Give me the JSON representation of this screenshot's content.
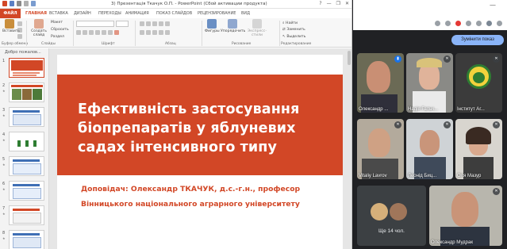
{
  "window": {
    "title": "3) Презентація Ткачук О.П. - PowerPoint (Сбой активации продукта)",
    "help": "?",
    "minimize": "—",
    "restore": "❐",
    "close": "✕"
  },
  "ribbon_tabs": [
    {
      "label": "ФАЙЛ",
      "active": false,
      "file": true
    },
    {
      "label": "ГЛАВНАЯ",
      "active": true
    },
    {
      "label": "ВСТАВКА"
    },
    {
      "label": "ДИЗАЙН"
    },
    {
      "label": "ПЕРЕХОДЫ"
    },
    {
      "label": "АНИМАЦИЯ"
    },
    {
      "label": "ПОКАЗ СЛАЙДОВ"
    },
    {
      "label": "РЕЦЕНЗИРОВАНИЕ"
    },
    {
      "label": "ВИД"
    }
  ],
  "ribbon": {
    "paste": "Вставить",
    "new_slide": "Создать слайд",
    "layout": "Макет",
    "reset": "Сбросить",
    "section": "Раздел",
    "shapes": "Фигуры",
    "arrange": "Упорядочить",
    "quick_styles": "Экспресс-стили",
    "find": "Найти",
    "replace": "Заменить",
    "select": "Выделить",
    "groups": {
      "clipboard": "Буфер обмена",
      "slides": "Слайды",
      "font": "Шрифт",
      "paragraph": "Абзац",
      "drawing": "Рисование",
      "editing": "Редактирование"
    }
  },
  "slides_panel": {
    "title": "Добро пожалов...",
    "slides": [
      {
        "number": "1",
        "selected": true
      },
      {
        "number": "2"
      },
      {
        "number": "3"
      },
      {
        "number": "4"
      },
      {
        "number": "5"
      },
      {
        "number": "6"
      },
      {
        "number": "7"
      },
      {
        "number": "8"
      }
    ]
  },
  "slide": {
    "title_lines": [
      "Ефективність застосування",
      "біопрепаратів у яблуневих",
      "садах інтенсивного типу"
    ],
    "subtitle_lines": [
      "Доповідач: Олександр ТКАЧУК, д.с.-г.н., професор",
      "Вінницького національного аграрного університету"
    ],
    "band_color": "#d24726"
  },
  "meet": {
    "pin_button": "Зумінити показ",
    "participants": [
      {
        "name": "Олександр ..."
      },
      {
        "name": "Надія Гальч..."
      },
      {
        "name": "Інститут Аг..."
      },
      {
        "name": "Vitaliy Lavrov"
      },
      {
        "name": "Леонід Биц..."
      },
      {
        "name": "Оля Мазур"
      },
      {
        "name": "Олександр Мудрак"
      }
    ],
    "more": "Ще 14 чол."
  }
}
